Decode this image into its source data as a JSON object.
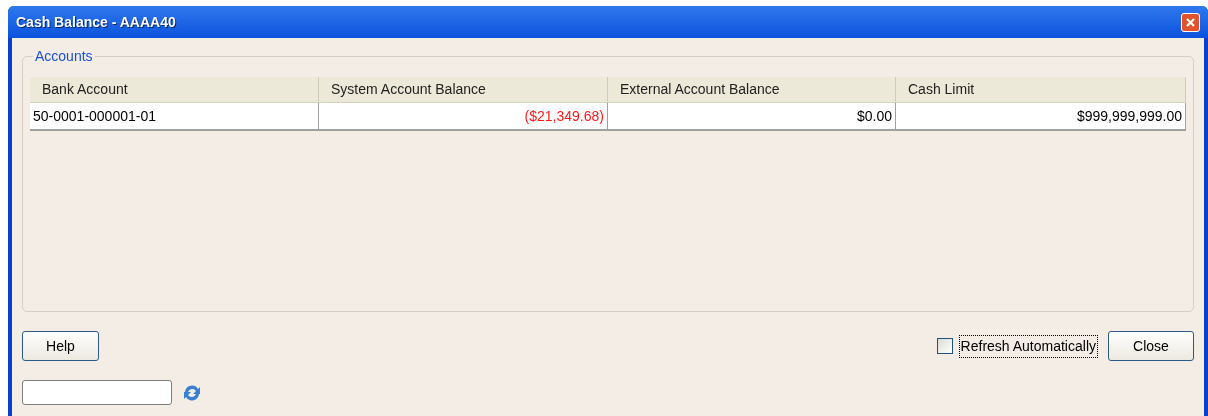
{
  "window": {
    "title": "Cash Balance - AAAA40"
  },
  "group": {
    "title": "Accounts"
  },
  "table": {
    "columns": [
      "Bank Account",
      "System Account Balance",
      "External Account Balance",
      "Cash Limit"
    ],
    "rows": [
      [
        {
          "text": "50-0001-000001-01",
          "negative": false
        },
        {
          "text": "($21,349.68)",
          "negative": true
        },
        {
          "text": "$0.00",
          "negative": false
        },
        {
          "text": "$999,999,999.00",
          "negative": false
        }
      ]
    ]
  },
  "help_button": "Help",
  "refresh_checkbox": {
    "label": "Refresh Automatically",
    "checked": false
  },
  "close_button": "Close"
}
